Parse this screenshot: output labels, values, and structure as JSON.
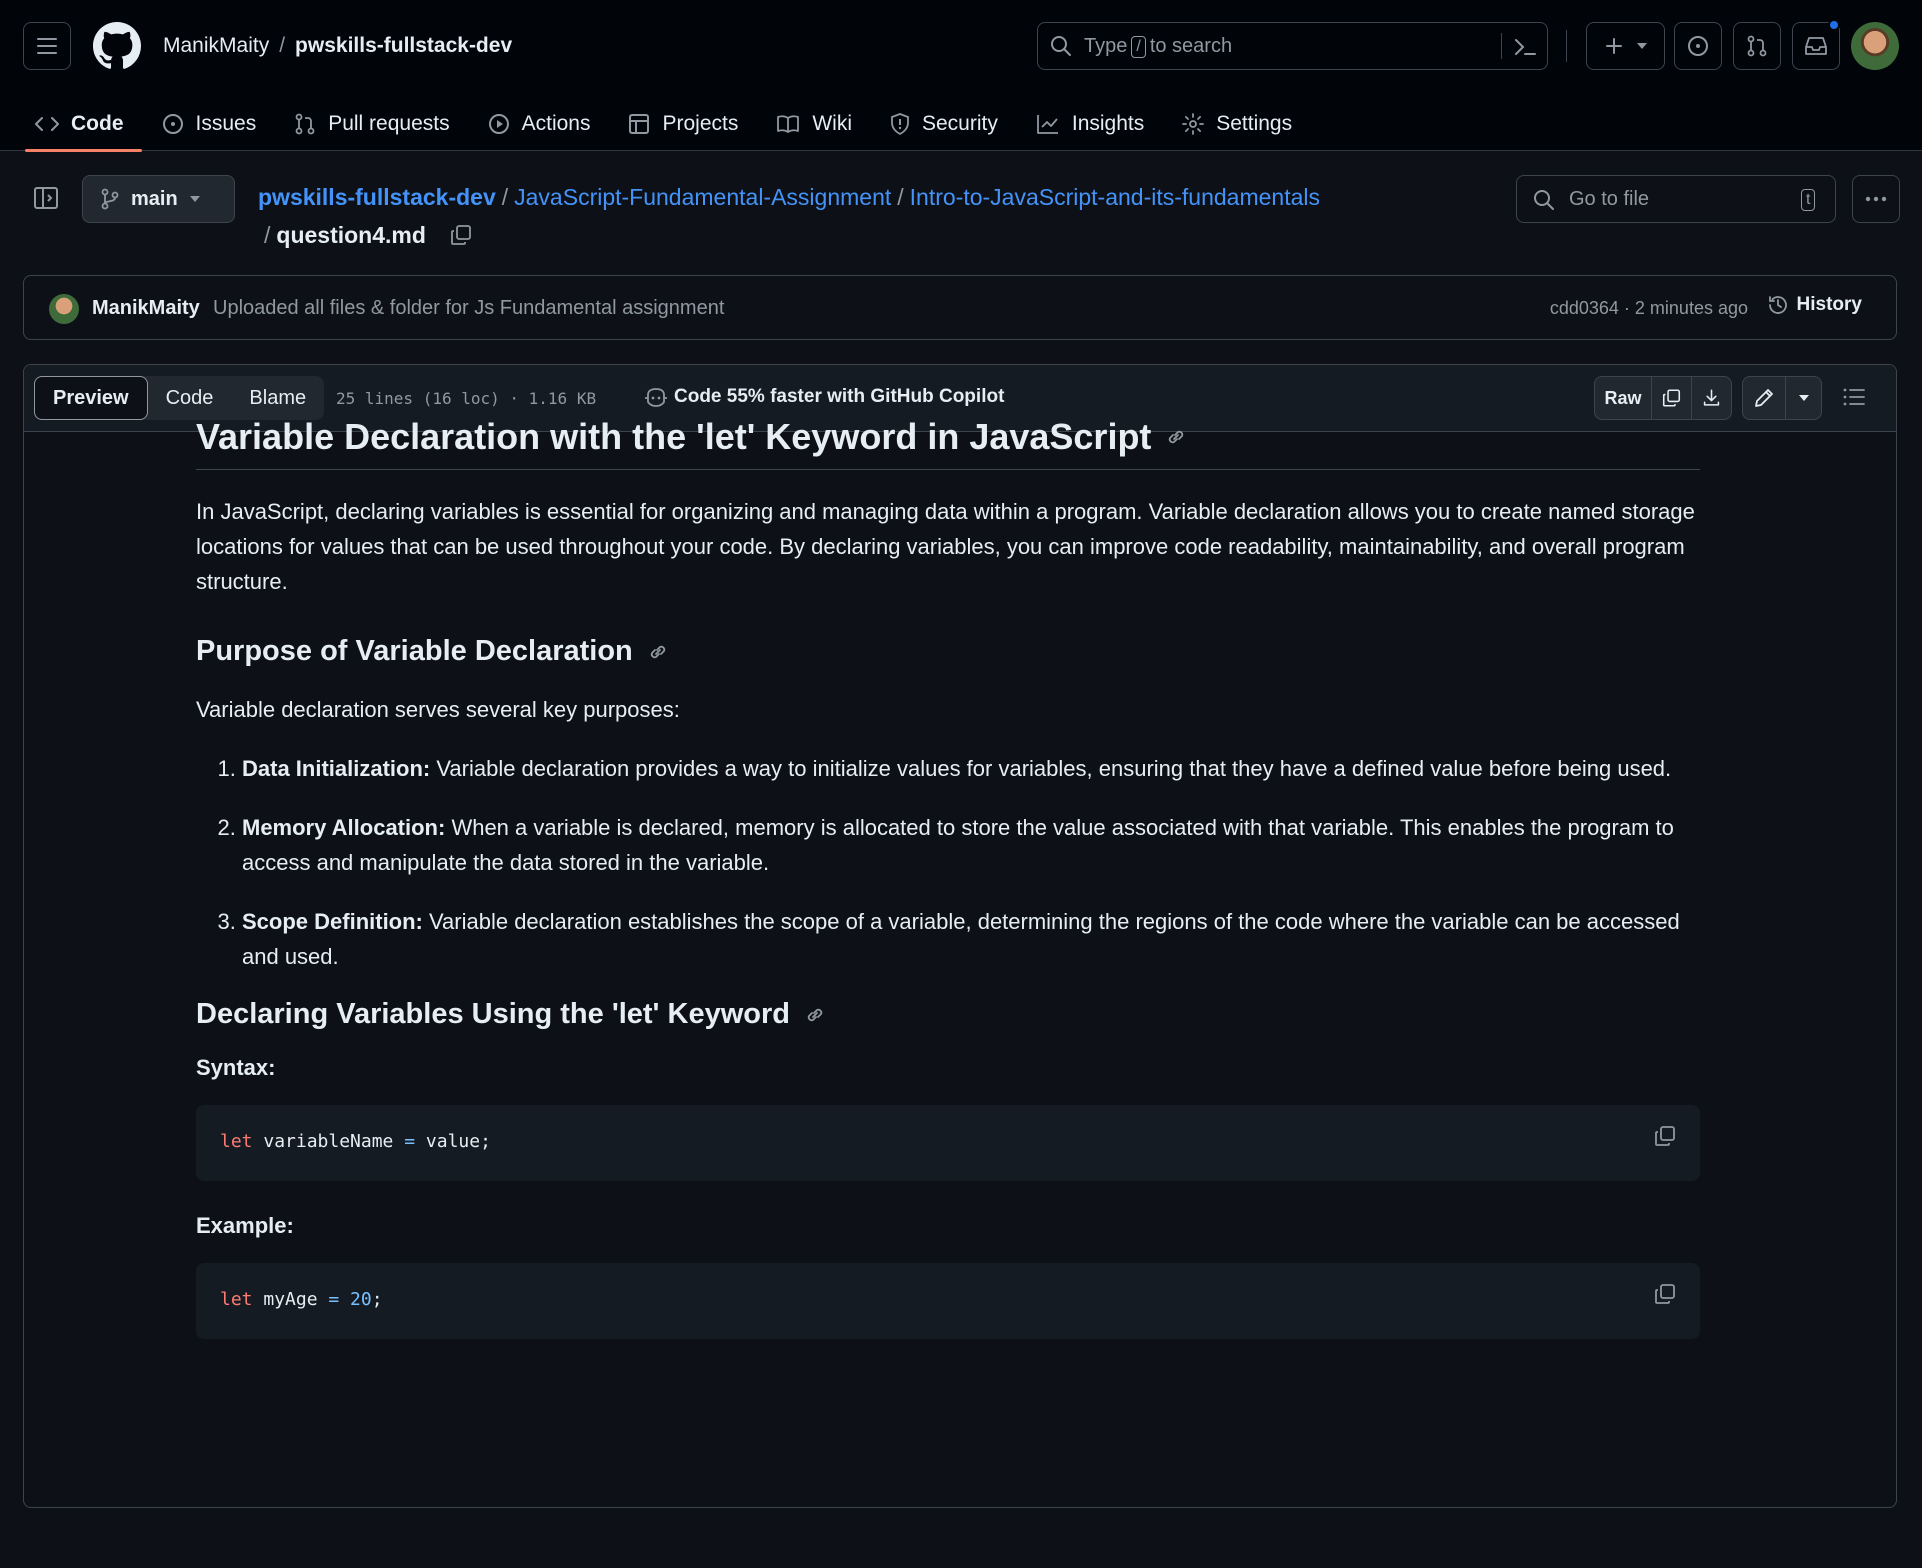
{
  "header": {
    "owner": "ManikMaity",
    "repo": "pwskills-fullstack-dev",
    "search_prefix": "Type",
    "search_key": "/",
    "search_suffix": "to search"
  },
  "nav_tabs": [
    "Code",
    "Issues",
    "Pull requests",
    "Actions",
    "Projects",
    "Wiki",
    "Security",
    "Insights",
    "Settings"
  ],
  "file_header": {
    "branch": "main",
    "path": [
      "pwskills-fullstack-dev",
      "JavaScript-Fundamental-Assignment",
      "Intro-to-JavaScript-and-its-fundamentals"
    ],
    "filename": "question4.md",
    "goto_placeholder": "Go to file",
    "goto_key": "t"
  },
  "commit": {
    "author": "ManikMaity",
    "message": "Uploaded all files & folder for Js Fundamental assignment",
    "sha_time": "cdd0364 · 2 minutes ago",
    "history": "History"
  },
  "toolbar": {
    "views": [
      "Preview",
      "Code",
      "Blame"
    ],
    "meta": "25 lines (16 loc) · 1.16 KB",
    "copilot": "Code 55% faster with GitHub Copilot",
    "raw": "Raw"
  },
  "content": {
    "h1": "Variable Declaration with the 'let' Keyword in JavaScript",
    "intro": "In JavaScript, declaring variables is essential for organizing and managing data within a program. Variable declaration allows you to create named storage locations for values that can be used throughout your code. By declaring variables, you can improve code readability, maintainability, and overall program structure.",
    "h2_purpose": "Purpose of Variable Declaration",
    "purpose_intro": "Variable declaration serves several key purposes:",
    "items": [
      {
        "term": "Data Initialization:",
        "text": " Variable declaration provides a way to initialize values for variables, ensuring that they have a defined value before being used."
      },
      {
        "term": "Memory Allocation:",
        "text": " When a variable is declared, memory is allocated to store the value associated with that variable. This enables the program to access and manipulate the data stored in the variable."
      },
      {
        "term": "Scope Definition:",
        "text": " Variable declaration establishes the scope of a variable, determining the regions of the code where the variable can be accessed and used."
      }
    ],
    "h2_let": "Declaring Variables Using the 'let' Keyword",
    "syntax_label": "Syntax:",
    "syntax_code": {
      "kw": "let",
      "name": " variableName ",
      "op": "=",
      "rest": " value;"
    },
    "example_label": "Example:",
    "example_code": {
      "kw": "let",
      "name": " myAge ",
      "op": "=",
      "num": " 20",
      "rest": ";"
    }
  }
}
